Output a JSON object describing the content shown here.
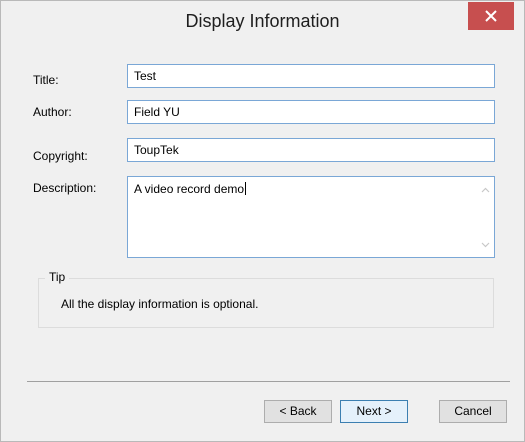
{
  "dialog": {
    "title": "Display Information"
  },
  "form": {
    "title_label": "Title:",
    "title_value": "Test",
    "author_label": "Author:",
    "author_value": "Field YU",
    "copyright_label": "Copyright:",
    "copyright_value": "ToupTek",
    "description_label": "Description:",
    "description_value": "A video record demo"
  },
  "tip": {
    "group_label": "Tip",
    "text": "All the display information is optional."
  },
  "buttons": {
    "back": "< Back",
    "next": "Next >",
    "cancel": "Cancel"
  },
  "colors": {
    "close_button": "#c74f4f",
    "field_border": "#7aa7d6"
  }
}
